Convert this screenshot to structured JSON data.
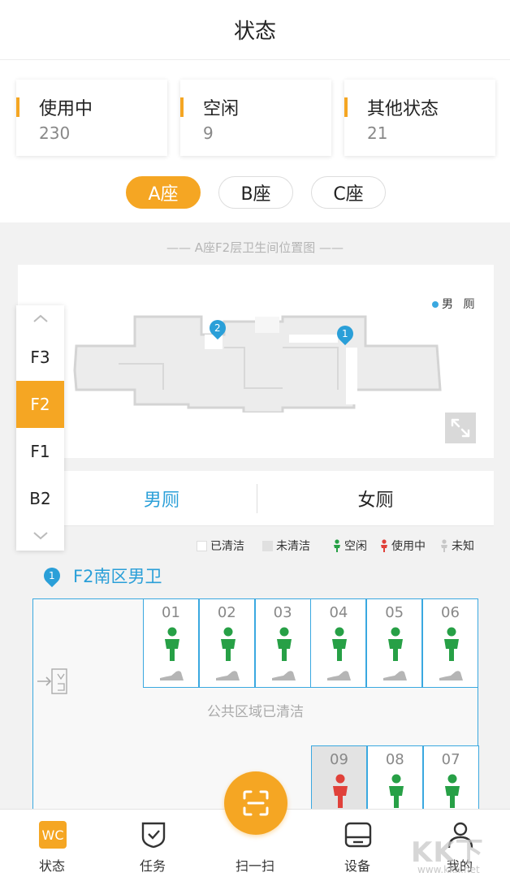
{
  "header": {
    "title": "状态"
  },
  "stats": [
    {
      "label": "使用中",
      "value": "230"
    },
    {
      "label": "空闲",
      "value": "9"
    },
    {
      "label": "其他状态",
      "value": "21"
    }
  ],
  "buildings": {
    "tabs": [
      "A座",
      "B座",
      "C座"
    ],
    "selected": "A座"
  },
  "map": {
    "caption": "—— A座F2层卫生间位置图 ——",
    "legend": "男 厕",
    "pins": [
      "1",
      "2"
    ]
  },
  "floors": {
    "items": [
      "F3",
      "F2",
      "F1",
      "B2"
    ],
    "selected": "F2"
  },
  "gender_tabs": {
    "items": [
      "男厕",
      "女厕"
    ],
    "selected": "男厕"
  },
  "status_legend": {
    "cleaned": "已清洁",
    "not_cleaned": "未清洁",
    "idle": "空闲",
    "in_use": "使用中",
    "unknown": "未知"
  },
  "section": {
    "pin": "1",
    "title": "F2南区男卫"
  },
  "stalls_top": [
    {
      "num": "01",
      "status": "idle"
    },
    {
      "num": "02",
      "status": "idle"
    },
    {
      "num": "03",
      "status": "idle"
    },
    {
      "num": "04",
      "status": "idle"
    },
    {
      "num": "05",
      "status": "idle"
    },
    {
      "num": "06",
      "status": "idle"
    }
  ],
  "stalls_bottom": [
    {
      "num": "09",
      "status": "in_use"
    },
    {
      "num": "08",
      "status": "idle"
    },
    {
      "num": "07",
      "status": "idle"
    }
  ],
  "public_area_text": "公共区域已清洁",
  "tabbar": {
    "items": [
      "状态",
      "任务",
      "扫一扫",
      "设备",
      "我的"
    ],
    "wc_badge": "WC"
  },
  "watermark": {
    "text": "KK下载",
    "url": "www.kkx.net"
  },
  "colors": {
    "accent": "#f5a623",
    "blue": "#2a9fd8",
    "idle": "#27a046",
    "in_use": "#e0413a",
    "unknown": "#c8c8c8"
  },
  "icons": [
    "chevron-up-icon",
    "chevron-down-icon",
    "expand-icon",
    "male-person-icon",
    "toilet-icon",
    "door-exit-icon",
    "wc-icon",
    "shield-check-icon",
    "scan-icon",
    "device-icon",
    "user-icon"
  ]
}
